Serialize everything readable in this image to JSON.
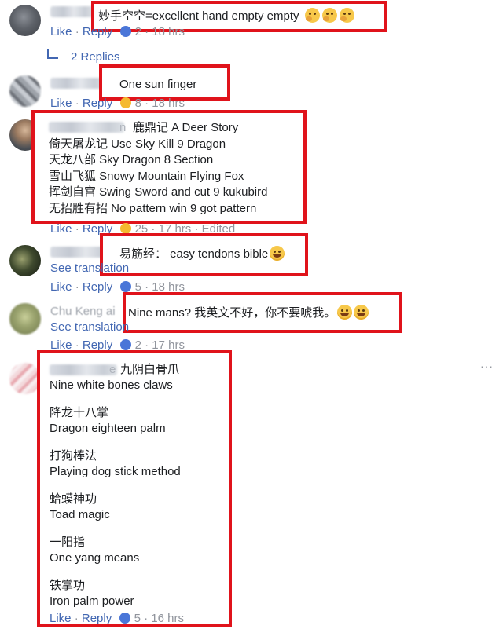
{
  "actions": {
    "like": "Like",
    "reply": "Reply",
    "dot": " · "
  },
  "comments": [
    {
      "lines": [
        "妙手空空=excellent hand empty empty"
      ],
      "count": "2",
      "time": "18 hrs",
      "reaction_color": "#4a76d8"
    },
    {
      "replies": "2 Replies"
    },
    {
      "lines": [
        "One sun finger"
      ],
      "count": "8",
      "time": "18 hrs",
      "reaction_color": "#f5b930"
    },
    {
      "name_suffix": "n",
      "lines": [
        "鹿鼎记 A Deer Story",
        "倚天屠龙记 Use Sky Kill 9 Dragon",
        "天龙八部 Sky Dragon 8 Section",
        "雪山飞狐 Snowy Mountain Flying Fox",
        "挥剑自宫 Swing Sword and cut 9 kukubird",
        "无招胜有招 No pattern win 9 got pattern"
      ],
      "count": "25",
      "time": "17 hrs",
      "edited": "Edited",
      "reaction_color": "#f5b930"
    },
    {
      "lines": [
        "易筋经：  easy tendons bible"
      ],
      "see_translation": "See translation",
      "count": "5",
      "time": "18 hrs",
      "reaction_color": "#4a76d8"
    },
    {
      "name_parts": [
        "Chu",
        "Keng",
        "ai"
      ],
      "lines": [
        "Nine mans? 我英文不好，你不要唬我。"
      ],
      "see_translation": "See translation",
      "count": "2",
      "time": "17 hrs",
      "reaction_color": "#4a76d8"
    },
    {
      "name_suffix": "e",
      "lines": [
        "九阴白骨爪",
        "Nine white bones claws",
        "降龙十八掌",
        "Dragon eighteen palm",
        "打狗棒法",
        "Playing dog stick method",
        "蛤蟆神功",
        "Toad magic",
        "一阳指",
        "One yang means",
        "铁掌功",
        "Iron palm power"
      ],
      "count": "5",
      "time": "16 hrs",
      "reaction_color": "#4a76d8"
    }
  ],
  "more_options": "···",
  "colors": {
    "highlight": "#e0131b",
    "link": "#4267b2",
    "meta": "#90949c"
  }
}
